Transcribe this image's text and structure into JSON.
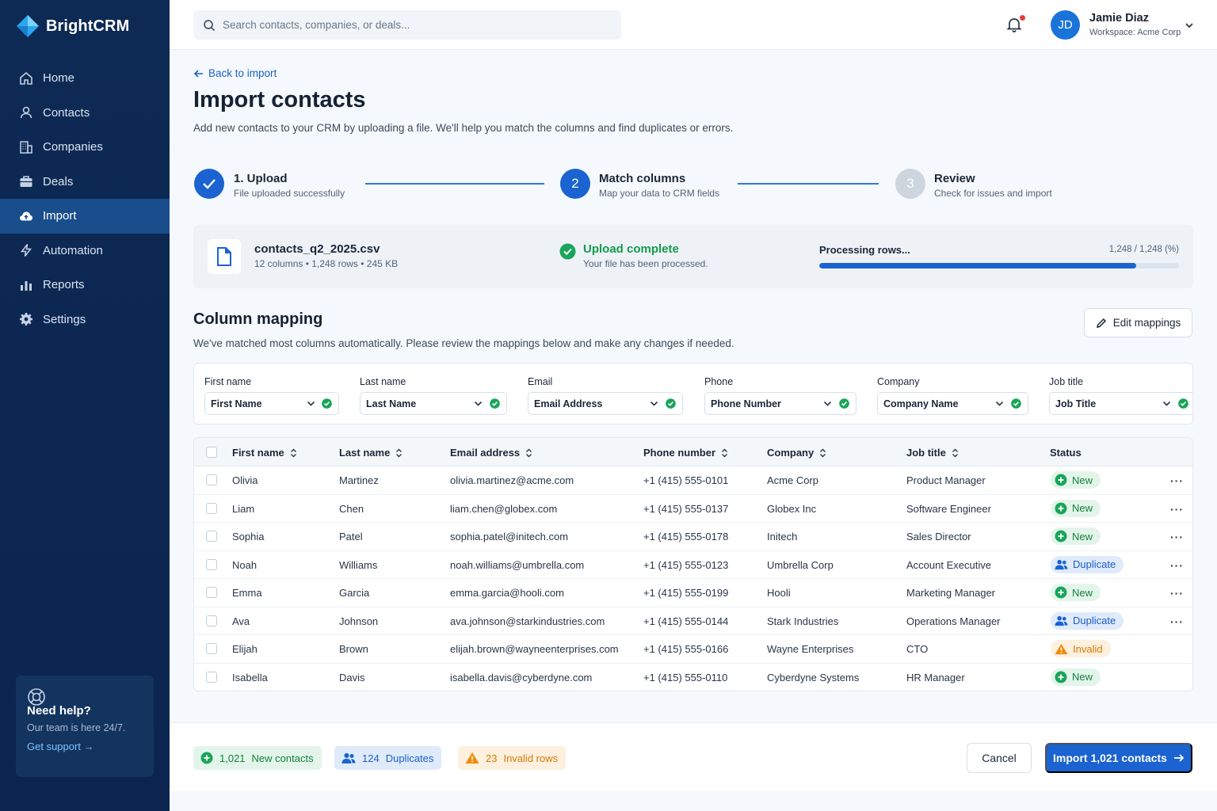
{
  "app": {
    "name": "BrightCRM"
  },
  "sidebar": {
    "items": [
      {
        "label": "Home",
        "icon": "home-icon"
      },
      {
        "label": "Contacts",
        "icon": "person-icon"
      },
      {
        "label": "Companies",
        "icon": "building-icon"
      },
      {
        "label": "Deals",
        "icon": "briefcase-icon"
      },
      {
        "label": "Import",
        "icon": "cloud-upload-icon",
        "active": true
      },
      {
        "label": "Automation",
        "icon": "lightning-icon"
      },
      {
        "label": "Reports",
        "icon": "bar-chart-icon"
      },
      {
        "label": "Settings",
        "icon": "gear-icon"
      }
    ],
    "help": {
      "title": "Need help?",
      "subtitle": "Our team is here 24/7.",
      "link": "Get support →"
    }
  },
  "header": {
    "search_placeholder": "Search contacts, companies, or deals...",
    "user": {
      "initials": "JD",
      "name": "Jamie Diaz",
      "workspace": "Workspace: Acme Corp"
    }
  },
  "page": {
    "back": "Back to import",
    "title": "Import contacts",
    "subtitle": "Add new contacts to your CRM by uploading a file. We'll help you match the columns and find duplicates or errors."
  },
  "steps": [
    {
      "number": "",
      "title": "1. Upload",
      "subtitle": "File uploaded successfully",
      "state": "done"
    },
    {
      "number": "2",
      "title": "Match columns",
      "subtitle": "Map your data to CRM fields",
      "state": "current"
    },
    {
      "number": "3",
      "title": "Review",
      "subtitle": "Check for issues and import",
      "state": "upcoming"
    }
  ],
  "file": {
    "name": "contacts_q2_2025.csv",
    "meta": "12 columns • 1,248 rows • 245 KB",
    "status_title": "Upload complete",
    "status_sub": "Your file has been processed.",
    "processing_label": "Processing rows...",
    "processing_count": "1,248 / 1,248 (%)",
    "progress": 0.88
  },
  "mapping": {
    "title": "Column mapping",
    "subtitle": "We've matched most columns automatically. Please review the mappings below and make any changes if needed.",
    "edit_button": "Edit mappings",
    "columns": [
      {
        "label": "First name",
        "value": "First Name"
      },
      {
        "label": "Last name",
        "value": "Last Name"
      },
      {
        "label": "Email",
        "value": "Email Address"
      },
      {
        "label": "Phone",
        "value": "Phone Number"
      },
      {
        "label": "Company",
        "value": "Company Name"
      },
      {
        "label": "Job title",
        "value": "Job Title"
      }
    ]
  },
  "table": {
    "headers": [
      "First name",
      "Last name",
      "Email address",
      "Phone number",
      "Company",
      "Job title",
      "Status"
    ],
    "rows": [
      {
        "first": "Olivia",
        "last": "Martinez",
        "email": "olivia.martinez@acme.com",
        "phone": "+1 (415) 555-0101",
        "company": "Acme Corp",
        "title": "Product Manager",
        "status": "New"
      },
      {
        "first": "Liam",
        "last": "Chen",
        "email": "liam.chen@globex.com",
        "phone": "+1 (415) 555-0137",
        "company": "Globex Inc",
        "title": "Software Engineer",
        "status": "New"
      },
      {
        "first": "Sophia",
        "last": "Patel",
        "email": "sophia.patel@initech.com",
        "phone": "+1 (415) 555-0178",
        "company": "Initech",
        "title": "Sales Director",
        "status": "New"
      },
      {
        "first": "Noah",
        "last": "Williams",
        "email": "noah.williams@umbrella.com",
        "phone": "+1 (415) 555-0123",
        "company": "Umbrella Corp",
        "title": "Account Executive",
        "status": "Duplicate"
      },
      {
        "first": "Emma",
        "last": "Garcia",
        "email": "emma.garcia@hooli.com",
        "phone": "+1 (415) 555-0199",
        "company": "Hooli",
        "title": "Marketing Manager",
        "status": "New"
      },
      {
        "first": "Ava",
        "last": "Johnson",
        "email": "ava.johnson@starkindustries.com",
        "phone": "+1 (415) 555-0144",
        "company": "Stark Industries",
        "title": "Operations Manager",
        "status": "Duplicate"
      },
      {
        "first": "Elijah",
        "last": "Brown",
        "email": "elijah.brown@wayneenterprises.com",
        "phone": "+1 (415) 555-0166",
        "company": "Wayne Enterprises",
        "title": "CTO",
        "status": "Invalid"
      },
      {
        "first": "Isabella",
        "last": "Davis",
        "email": "isabella.davis@cyberdyne.com",
        "phone": "+1 (415) 555-0110",
        "company": "Cyberdyne Systems",
        "title": "HR Manager",
        "status": "New"
      }
    ]
  },
  "summary": {
    "new_count": "1,021",
    "new_label": "New contacts",
    "dup_count": "124",
    "dup_label": "Duplicates",
    "invalid_count": "23",
    "invalid_label": "Invalid rows"
  },
  "actions": {
    "cancel": "Cancel",
    "import": "Import 1,021 contacts"
  },
  "colors": {
    "primary": "#1a63d0",
    "sidebar": "#0d2a54",
    "success": "#149a4c",
    "warning": "#d67a05"
  }
}
